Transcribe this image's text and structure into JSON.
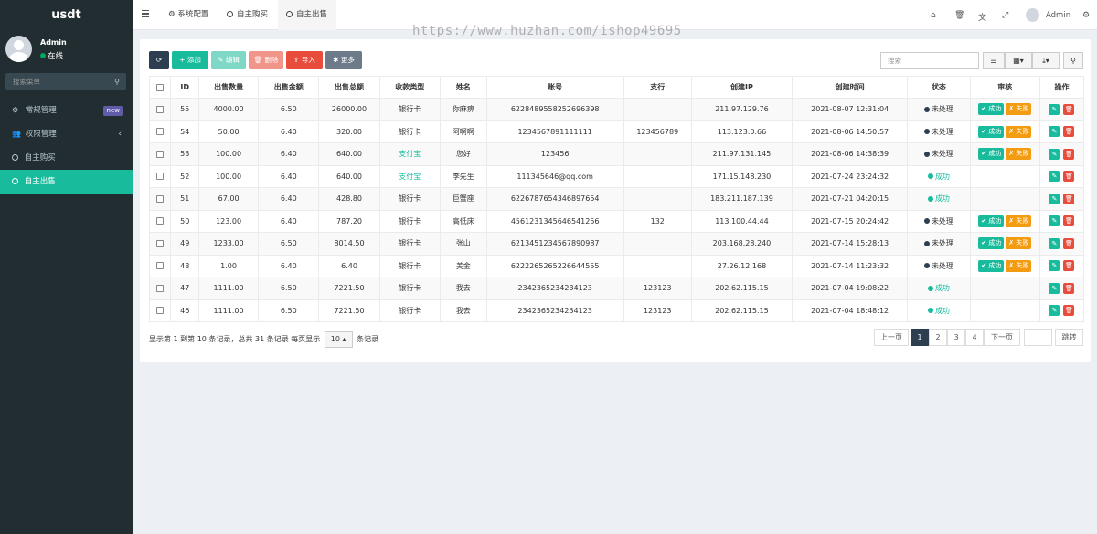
{
  "brand": "usdt",
  "user": {
    "name": "Admin",
    "status": "在线"
  },
  "sidebar": {
    "search_placeholder": "搜索菜单",
    "items": [
      {
        "label": "常规管理",
        "badge": "new",
        "icon": "gears-icon"
      },
      {
        "label": "权限管理",
        "icon": "users-icon",
        "chevron": "‹"
      },
      {
        "label": "自主购买",
        "icon": "circle-icon"
      },
      {
        "label": "自主出售",
        "icon": "circle-icon",
        "active": true
      }
    ]
  },
  "topbar": {
    "tabs": [
      {
        "label": "系统配置",
        "icon": "gear-icon"
      },
      {
        "label": "自主购买",
        "icon": "circle-icon"
      },
      {
        "label": "自主出售",
        "icon": "circle-icon",
        "active": true
      }
    ],
    "admin_name": "Admin"
  },
  "watermark": "https://www.huzhan.com/ishop49695",
  "toolbar": {
    "refresh": "⟳",
    "add": "+ 添加",
    "edit": "✎ 编辑",
    "delete": "🗑 删除",
    "import": "⇪ 导入",
    "more": "✱ 更多",
    "search_placeholder": "搜索"
  },
  "table": {
    "headers": [
      "ID",
      "出售数量",
      "出售金额",
      "出售总额",
      "收款类型",
      "姓名",
      "账号",
      "支行",
      "创建IP",
      "创建时间",
      "状态",
      "审核",
      "操作"
    ],
    "rows": [
      {
        "id": "55",
        "qty": "4000.00",
        "price": "6.50",
        "total": "26000.00",
        "type": "银行卡",
        "name": "你麻痹",
        "account": "6228489558252696398",
        "branch": "",
        "ip": "211.97.129.76",
        "time": "2021-08-07 12:31:04",
        "status": "未处理",
        "review": true
      },
      {
        "id": "54",
        "qty": "50.00",
        "price": "6.40",
        "total": "320.00",
        "type": "银行卡",
        "name": "阿啊啊",
        "account": "1234567891111111",
        "branch": "123456789",
        "ip": "113.123.0.66",
        "time": "2021-08-06 14:50:57",
        "status": "未处理",
        "review": true
      },
      {
        "id": "53",
        "qty": "100.00",
        "price": "6.40",
        "total": "640.00",
        "type": "支付宝",
        "name": "您好",
        "account": "123456",
        "branch": "",
        "ip": "211.97.131.145",
        "time": "2021-08-06 14:38:39",
        "status": "未处理",
        "review": true
      },
      {
        "id": "52",
        "qty": "100.00",
        "price": "6.40",
        "total": "640.00",
        "type": "支付宝",
        "name": "李先生",
        "account": "111345646@qq.com",
        "branch": "",
        "ip": "171.15.148.230",
        "time": "2021-07-24 23:24:32",
        "status": "成功",
        "review": false
      },
      {
        "id": "51",
        "qty": "67.00",
        "price": "6.40",
        "total": "428.80",
        "type": "银行卡",
        "name": "巨蟹座",
        "account": "6226787654346897654",
        "branch": "",
        "ip": "183.211.187.139",
        "time": "2021-07-21 04:20:15",
        "status": "成功",
        "review": false
      },
      {
        "id": "50",
        "qty": "123.00",
        "price": "6.40",
        "total": "787.20",
        "type": "银行卡",
        "name": "高低床",
        "account": "4561231345646541256",
        "branch": "132",
        "ip": "113.100.44.44",
        "time": "2021-07-15 20:24:42",
        "status": "未处理",
        "review": true
      },
      {
        "id": "49",
        "qty": "1233.00",
        "price": "6.50",
        "total": "8014.50",
        "type": "银行卡",
        "name": "张山",
        "account": "6213451234567890987",
        "branch": "",
        "ip": "203.168.28.240",
        "time": "2021-07-14 15:28:13",
        "status": "未处理",
        "review": true
      },
      {
        "id": "48",
        "qty": "1.00",
        "price": "6.40",
        "total": "6.40",
        "type": "银行卡",
        "name": "美金",
        "account": "6222265265226644555",
        "branch": "",
        "ip": "27.26.12.168",
        "time": "2021-07-14 11:23:32",
        "status": "未处理",
        "review": true
      },
      {
        "id": "47",
        "qty": "1111.00",
        "price": "6.50",
        "total": "7221.50",
        "type": "银行卡",
        "name": "我去",
        "account": "2342365234234123",
        "branch": "123123",
        "ip": "202.62.115.15",
        "time": "2021-07-04 19:08:22",
        "status": "成功",
        "review": false
      },
      {
        "id": "46",
        "qty": "1111.00",
        "price": "6.50",
        "total": "7221.50",
        "type": "银行卡",
        "name": "我去",
        "account": "2342365234234123",
        "branch": "123123",
        "ip": "202.62.115.15",
        "time": "2021-07-04 18:48:12",
        "status": "成功",
        "review": false
      }
    ],
    "review_ok": "✔ 成功",
    "review_fail": "✗ 失败"
  },
  "footer": {
    "info": "显示第 1 到第 10 条记录，总共 31 条记录 每页显示",
    "page_size": "10 ▴",
    "suffix": "条记录",
    "prev": "上一页",
    "pages": [
      "1",
      "2",
      "3",
      "4"
    ],
    "next": "下一页",
    "jump": "跳转"
  },
  "colors": {
    "accent": "#18bc9c",
    "sidebar": "#222d32",
    "danger": "#e74c3c",
    "warning": "#f39c12"
  }
}
